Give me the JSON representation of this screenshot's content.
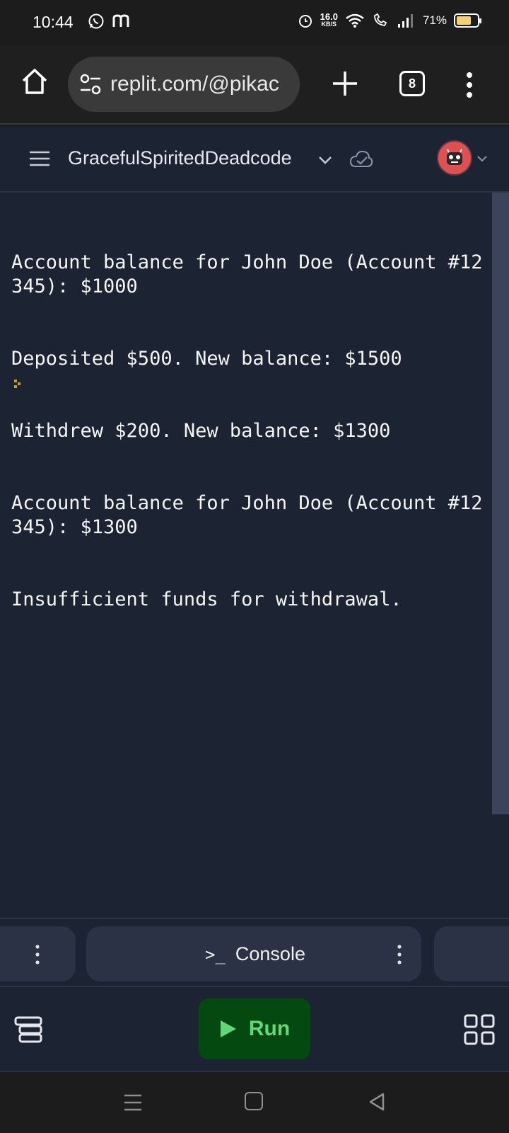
{
  "status_bar": {
    "time": "10:44",
    "left_icons": [
      "whatsapp-icon",
      "m-app-icon"
    ],
    "network_speed": "16.0",
    "network_speed_unit": "KB/S",
    "battery_percent": "71%",
    "battery_level": 0.71,
    "battery_color": "#f3d36a"
  },
  "browser": {
    "url": "replit.com/@pikac",
    "tab_count": "8"
  },
  "replit": {
    "repl_name": "GracefulSpiritedDeadcode",
    "console_lines": [
      "Account balance for John Doe (Account #12345): $1000",
      "Deposited $500. New balance: $1500",
      "Withdrew $200. New balance: $1300",
      "Account balance for John Doe (Account #12345): $1300",
      "Insufficient funds for withdrawal."
    ],
    "panel_tab_label": "Console",
    "panel_tab_icon": ">_",
    "run_label": "Run",
    "run_color": "#5fd87a",
    "run_bg": "#044a10",
    "background": "#1c2333"
  }
}
